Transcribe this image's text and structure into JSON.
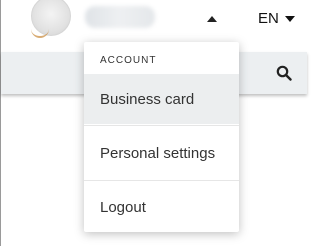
{
  "header": {
    "language": "EN",
    "language_caret_icon": "caret-down-icon",
    "menu_caret_icon": "caret-up-icon"
  },
  "search": {
    "icon": "search-icon"
  },
  "account_menu": {
    "section_label": "ACCOUNT",
    "items": [
      {
        "label": "Business card",
        "highlighted": true
      },
      {
        "label": "Personal settings",
        "highlighted": false
      },
      {
        "label": "Logout",
        "highlighted": false
      }
    ]
  }
}
